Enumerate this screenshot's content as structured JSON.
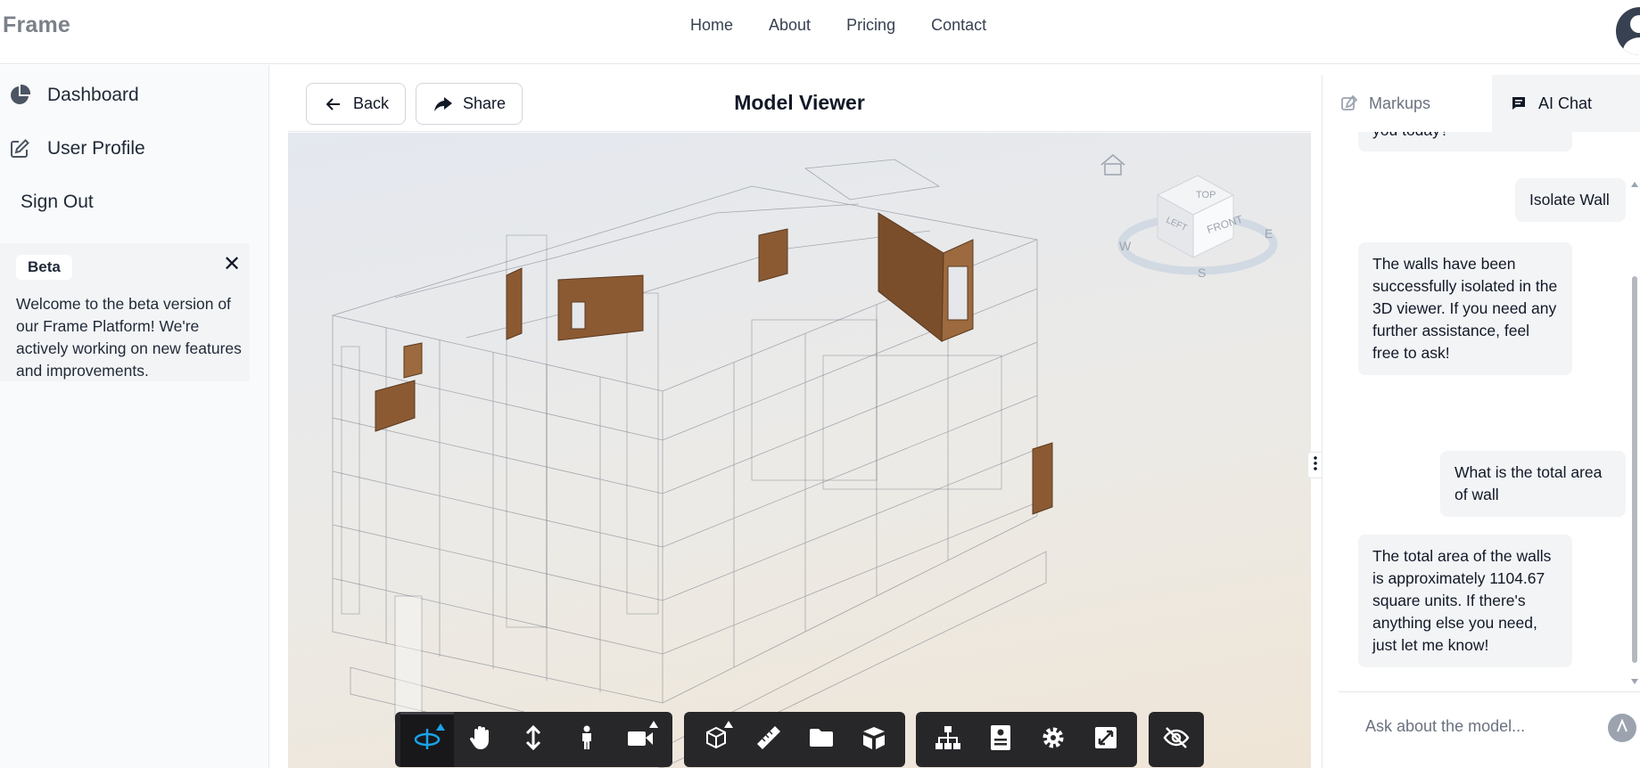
{
  "app": {
    "logo": "Frame"
  },
  "nav": {
    "home": "Home",
    "about": "About",
    "pricing": "Pricing",
    "contact": "Contact"
  },
  "sidebar": {
    "items": [
      {
        "label": "Dashboard",
        "icon": "pie-chart-icon"
      },
      {
        "label": "User Profile",
        "icon": "edit-icon"
      },
      {
        "label": "Sign Out"
      }
    ],
    "beta": {
      "badge": "Beta",
      "text": "Welcome to the beta version of our Frame Platform! We're actively working on new features and improvements."
    }
  },
  "viewer": {
    "title": "Model Viewer",
    "back_label": "Back",
    "share_label": "Share",
    "cube": {
      "top": "TOP",
      "front": "FRONT",
      "left": "LEFT",
      "w": "W",
      "e": "E",
      "s": "S"
    },
    "toolbar": {
      "group1": [
        "orbit-icon",
        "pan-hand-icon",
        "zoom-vertical-icon",
        "first-person-icon",
        "camera-icon"
      ],
      "group2": [
        "section-box-icon",
        "measure-icon",
        "folder-icon",
        "explode-icon"
      ],
      "group3": [
        "model-tree-icon",
        "properties-icon",
        "settings-icon",
        "fullscreen-icon"
      ],
      "group4": [
        "hide-icon"
      ]
    }
  },
  "panel": {
    "tabs": [
      {
        "label": "Markups",
        "icon": "markup-pen-icon"
      },
      {
        "label": "AI Chat",
        "icon": "chat-icon"
      }
    ],
    "messages": [
      {
        "role": "ai",
        "text": "you today?"
      },
      {
        "role": "user",
        "text": "Isolate Wall"
      },
      {
        "role": "ai",
        "text": "The walls have been successfully isolated in the 3D viewer. If you need any further assistance, feel free to ask!"
      },
      {
        "role": "user",
        "text": "What is the total area of wall"
      },
      {
        "role": "ai",
        "text": "The total area of the walls is approximately 1104.67 square units. If there's anything else you need, just let me know!"
      }
    ],
    "input_placeholder": "Ask about the model..."
  },
  "colors": {
    "accent": "#1aa3e8",
    "toolbar": "#27272a",
    "highlight": "#8b5a33"
  }
}
